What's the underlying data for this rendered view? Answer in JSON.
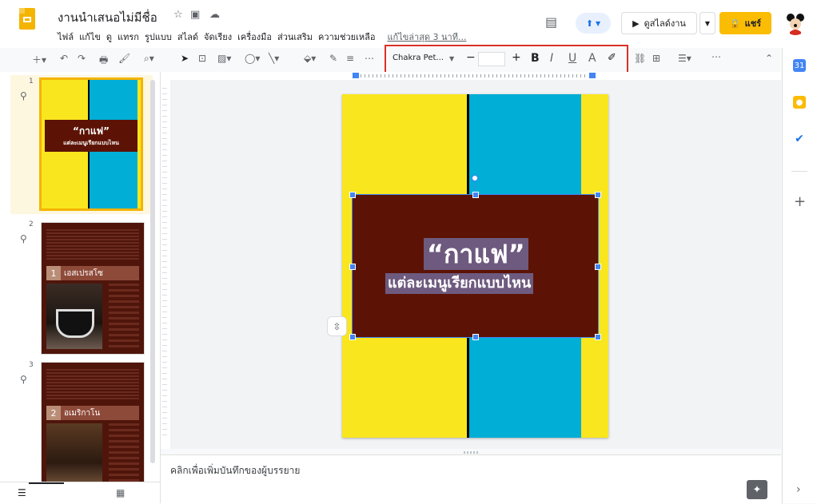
{
  "header": {
    "doc_title": "งานนำเสนอไม่มีชื่อ",
    "menu": [
      "ไฟล์",
      "แก้ไข",
      "ดู",
      "แทรก",
      "รูปแบบ",
      "สไลด์",
      "จัดเรียง",
      "เครื่องมือ",
      "ส่วนเสริม",
      "ความช่วยเหลือ"
    ],
    "last_edit": "แก้ไขล่าสุด 3 นาที...",
    "present_label": "ดูสไลด์งาน",
    "share_label": "แชร์"
  },
  "toolbar": {
    "font_name": "Chakra Pet...",
    "bold": "B",
    "italic": "I",
    "underline": "U",
    "text_color": "A",
    "minus": "−",
    "plus": "+"
  },
  "filmstrip": {
    "slides": [
      {
        "number": "1",
        "title": "“กาแฟ”",
        "subtitle": "แต่ละเมนูเรียกแบบไหน"
      },
      {
        "number": "2",
        "banner_num": "1",
        "banner": "เอสเปรสโซ"
      },
      {
        "number": "3",
        "banner_num": "2",
        "banner": "อเมริกาโน"
      }
    ]
  },
  "slide": {
    "title": "“กาแฟ”",
    "subtitle": "แต่ละเมนูเรียกแบบไหน"
  },
  "notes": {
    "placeholder": "คลิกเพื่อเพิ่มบันทึกของผู้บรรยาย"
  },
  "colors": {
    "slide_yellow": "#f9e61e",
    "slide_blue": "#00aed6",
    "box_brown": "#5c1305",
    "highlight_red": "#d93025",
    "share_yellow": "#fbbc04"
  }
}
